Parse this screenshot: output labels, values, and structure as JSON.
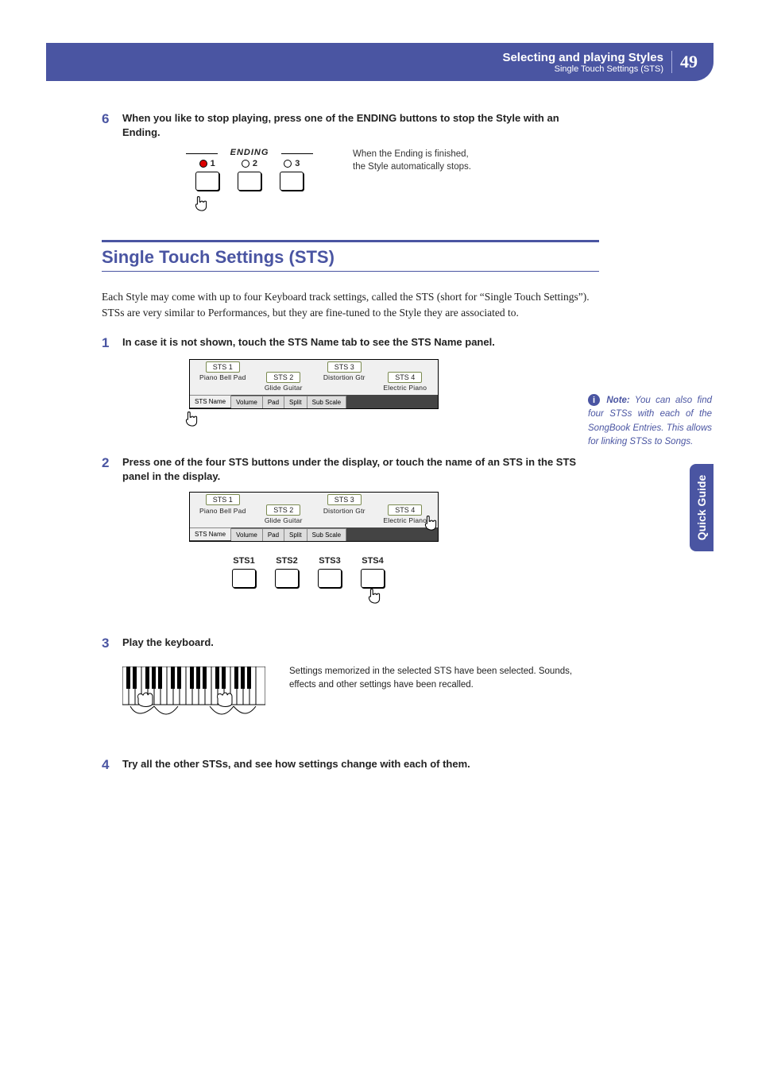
{
  "header": {
    "title": "Selecting and playing Styles",
    "subtitle": "Single Touch Settings (STS)",
    "page": "49"
  },
  "sideTab": "Quick Guide",
  "step6": {
    "num": "6",
    "text": "When you like to stop playing, press one of the ENDING buttons to stop the Style with an Ending.",
    "endingLabel": "ENDING",
    "leds": [
      "1",
      "2",
      "3"
    ],
    "caption": "When the Ending is finished, the Style automatically stops."
  },
  "section": {
    "title": "Single Touch Settings (STS)",
    "intro": "Each Style may come with up to four Keyboard track settings, called the STS (short for “Single Touch Settings”). STSs are very similar to Performances, but they are fine-tuned to the Style they are associated to."
  },
  "note": {
    "label": "Note:",
    "text": "You can also find four STSs with each of the SongBook Entries. This allows for linking STSs to Songs."
  },
  "stsPanel": {
    "sts": [
      {
        "pill": "STS 1",
        "name": "Piano Bell Pad"
      },
      {
        "pill": "STS 2",
        "name": "Glide Guitar"
      },
      {
        "pill": "STS 3",
        "name": "Distortion Gtr"
      },
      {
        "pill": "STS 4",
        "name": "Electric Piano"
      }
    ],
    "tabs": [
      "STS Name",
      "Volume",
      "Pad",
      "Split",
      "Sub Scale"
    ]
  },
  "step1": {
    "num": "1",
    "text": "In case it is not shown, touch the STS Name tab to see the STS Name panel."
  },
  "step2": {
    "num": "2",
    "text": "Press one of the four STS buttons under the display, or touch the name of an STS in the STS panel in the display.",
    "hwLabels": [
      "STS1",
      "STS2",
      "STS3",
      "STS4"
    ]
  },
  "step3": {
    "num": "3",
    "text": "Play the keyboard.",
    "caption": "Settings memorized in the selected STS have been selected. Sounds, effects and other settings have been recalled."
  },
  "step4": {
    "num": "4",
    "text": "Try all the other STSs, and see how settings change with each of them."
  }
}
